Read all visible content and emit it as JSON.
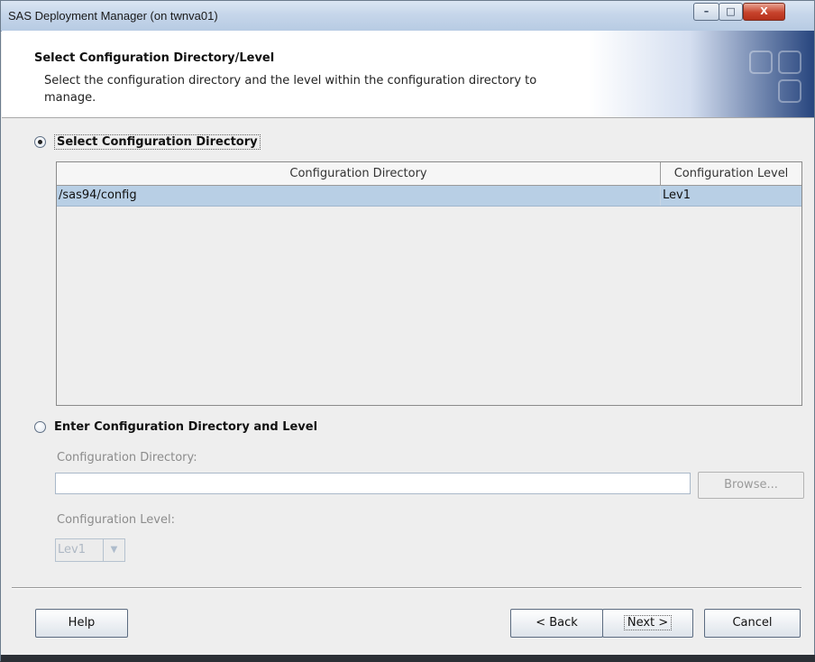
{
  "window": {
    "title": "SAS Deployment Manager (on twnva01)",
    "controls": {
      "minimize": "–",
      "maximize": "□",
      "close": "X"
    }
  },
  "header": {
    "title": "Select Configuration Directory/Level",
    "description": "Select the configuration directory and the level within the configuration directory to manage."
  },
  "select_section": {
    "radio_label": "Select Configuration Directory",
    "selected": true,
    "table": {
      "columns": [
        "Configuration Directory",
        "Configuration Level"
      ],
      "rows": [
        {
          "directory": "/sas94/config",
          "level": "Lev1",
          "selected": true
        }
      ]
    }
  },
  "enter_section": {
    "radio_label": "Enter Configuration Directory and Level",
    "selected": false,
    "directory_label": "Configuration Directory:",
    "directory_value": "",
    "browse_label": "Browse...",
    "level_label": "Configuration Level:",
    "level_value": "Lev1"
  },
  "footer": {
    "help": "Help",
    "back": "< Back",
    "next": "Next >",
    "cancel": "Cancel"
  },
  "colors": {
    "selection_row": "#b8cfe5",
    "header_gradient_end": "#27457e",
    "disabled_text": "#8c8c8c"
  }
}
